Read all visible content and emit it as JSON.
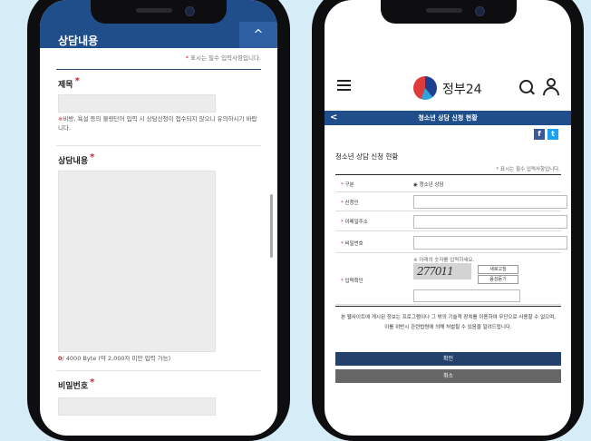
{
  "left_phone": {
    "header_title": "상담내용",
    "toggle_glyph": "^",
    "required_note": "표시는 필수 입력사항입니다.",
    "required_star": "*",
    "fields": {
      "title_label": "제목",
      "title_warning_mark": "※",
      "title_warning": "비방, 욕설 등의 불량단어 입력 시 상담신청이 접수되지 않으니 유의하시기 바랍니다.",
      "content_label": "상담내용",
      "byte_count": "0",
      "byte_limit": "/ 4000 Byte (약 2,000자 미만 입력 가능)",
      "password_label": "비밀번호"
    }
  },
  "right_phone": {
    "logo_text": "정부24",
    "page_bar_title": "청소년 상담 신청 현황",
    "back_glyph": "<",
    "share": {
      "facebook": "f",
      "twitter": "t"
    },
    "section_title": "청소년 상담 신청 현황",
    "required_note": "* 표시는 필수 입력사항입니다.",
    "form": {
      "type_label": "구분",
      "type_value": "◉ 청소년 상담",
      "applicant_label": "신청인",
      "email_label": "이메일주소",
      "password_label": "비밀번호",
      "captcha_hint": "※ 아래의 숫자를 입력하세요.",
      "captcha_label": "입력확인",
      "captcha_code": "277011",
      "refresh_button": "새로고침",
      "audio_button": "음성듣기"
    },
    "notice_line1": "본 웹사이트에 게시된 정보는 프로그램이나 그 밖의 기술적 장치를 이용하여 무단으로 사용할 수 없으며,",
    "notice_line2": "이를 위반시 관련법령에 의해 처벌될 수 있음을 알려드립니다.",
    "confirm_button": "확인",
    "cancel_button": "취소"
  },
  "colors": {
    "header_blue": "#1f4e8a",
    "required_red": "#d3202a",
    "confirm_button": "#23416b",
    "cancel_button": "#666666",
    "facebook": "#3b5998",
    "twitter": "#1da1f2"
  }
}
